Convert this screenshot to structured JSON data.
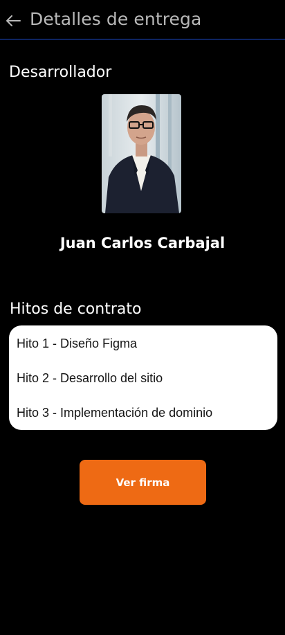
{
  "header": {
    "title": "Detalles de entrega",
    "back_icon": "arrow-left-icon"
  },
  "developer": {
    "section_title": "Desarrollador",
    "name": "Juan Carlos Carbajal",
    "photo_icon": "profile-photo"
  },
  "milestones": {
    "section_title": "Hitos de contrato",
    "items": [
      "Hito 1 - Diseño Figma",
      "Hito 2 - Desarrollo del sitio",
      "Hito 3 - Implementación de dominio"
    ]
  },
  "action": {
    "label": "Ver firma"
  },
  "colors": {
    "background": "#000000",
    "header_divider": "#1e4fd6",
    "card": "#ffffff",
    "accent": "#ee6a14"
  }
}
